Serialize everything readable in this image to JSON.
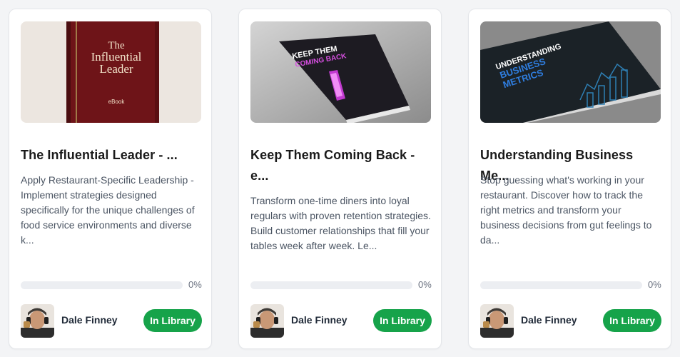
{
  "progress_label": "0%",
  "cards": [
    {
      "title": "The Influential Leader - ...",
      "description": "Apply Restaurant-Specific Leadership - Implement strategies designed specifically for the unique challenges of food service environments and diverse k...",
      "cover_title_lines": [
        "The",
        "Influential",
        "Leader"
      ],
      "cover_subtitle": "eBook",
      "progress": 0,
      "author": "Dale Finney",
      "status": "In Library"
    },
    {
      "title": "Keep Them Coming Back - e...",
      "description": "Transform one-time diners into loyal regulars with proven retention strategies. Build customer relationships that fill your tables week after week. Le...",
      "cover_title_lines": [
        "KEEP THEM",
        "COMING BACK"
      ],
      "progress": 0,
      "author": "Dale Finney",
      "status": "In Library"
    },
    {
      "title": "Understanding Business Me...",
      "description": "Stop guessing what's working in your restaurant. Discover how to track the right metrics and transform your business decisions from gut feelings to da...",
      "cover_title_lines": [
        "UNDERSTANDING",
        "BUSINESS",
        "METRICS"
      ],
      "progress": 0,
      "author": "Dale Finney",
      "status": "In Library"
    }
  ],
  "colors": {
    "accent_green": "#16a34a",
    "card_border": "#e4e6ea",
    "page_background": "#f3f4f6"
  },
  "icons": {
    "author_avatar": "person-with-headphones-photo"
  }
}
